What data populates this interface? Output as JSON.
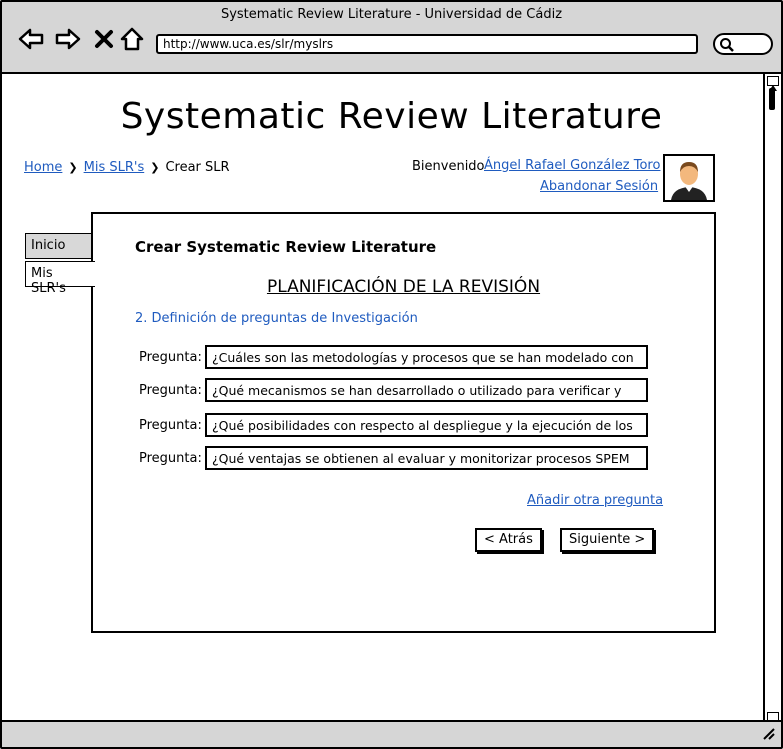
{
  "browser": {
    "window_title": "Systematic Review Literature - Universidad de Cádiz",
    "url": "http://www.uca.es/slr/myslrs"
  },
  "header": {
    "site_title": "Systematic Review Literature",
    "welcome_text": "Bienvenido",
    "user_name": "Ángel Rafael González Toro",
    "logout_label": "Abandonar Sesión"
  },
  "breadcrumb": {
    "home": "Home",
    "myslrs": "Mis SLR's",
    "current": "Crear SLR",
    "separator": "❯"
  },
  "sidebar": {
    "tabs": [
      {
        "label": "Inicio"
      },
      {
        "label": "Mis SLR's"
      }
    ]
  },
  "panel": {
    "title": "Crear Systematic Review Literature",
    "section_title": "PLANIFICACIÓN DE LA REVISIÓN",
    "step_label": "2. Definición de preguntas de Investigación",
    "question_label": "Pregunta:",
    "questions": [
      "¿Cuáles son las metodologías y procesos que se han modelado con",
      "¿Qué mecanismos se han desarrollado o utilizado para verificar y",
      "¿Qué posibilidades con respecto al despliegue y la ejecución de los",
      "¿Qué ventajas se obtienen al evaluar y monitorizar procesos SPEM"
    ],
    "add_question_label": "Añadir otra pregunta",
    "back_label": "< Atrás",
    "next_label": "Siguiente >"
  },
  "colors": {
    "link": "#1f5bbf",
    "chrome": "#d6d6d6"
  },
  "icons": [
    "back-arrow-icon",
    "forward-arrow-icon",
    "close-icon",
    "home-icon",
    "search-icon",
    "user-avatar-icon",
    "resize-grip-icon"
  ]
}
